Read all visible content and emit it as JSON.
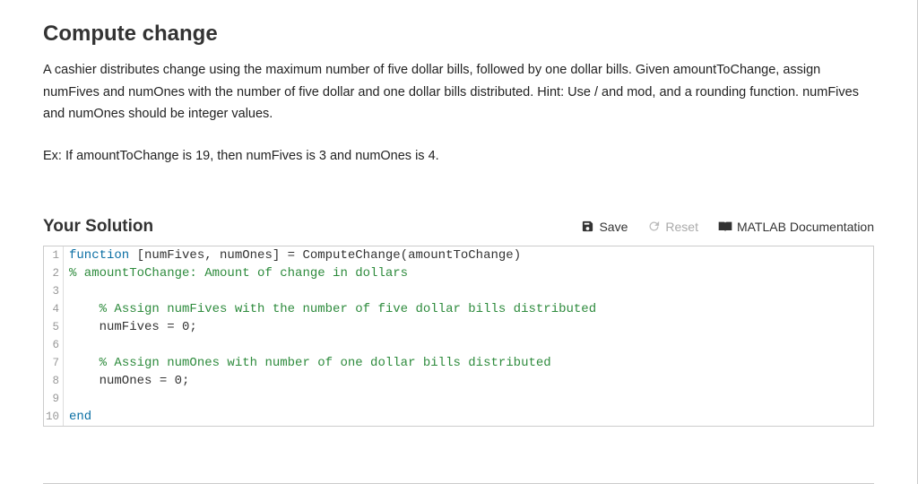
{
  "title": "Compute change",
  "description": "A cashier distributes change using the maximum number of five dollar bills, followed by one dollar bills. Given amountToChange, assign numFives and numOnes with the number of five dollar and one dollar bills distributed. Hint: Use  / and mod, and a rounding function. numFives and numOnes should be integer values.",
  "example": "Ex: If amountToChange is 19, then numFives is 3 and numOnes is 4.",
  "solution": {
    "heading": "Your Solution",
    "actions": {
      "save": "Save",
      "reset": "Reset",
      "docs": "MATLAB Documentation"
    }
  },
  "code": {
    "lines": [
      {
        "n": "1",
        "html": "<span class=\"kw\">function</span> [numFives, numOnes] = ComputeChange(amountToChange)"
      },
      {
        "n": "2",
        "html": "<span class=\"com\">% amountToChange: Amount of change in dollars</span>"
      },
      {
        "n": "3",
        "html": ""
      },
      {
        "n": "4",
        "html": "    <span class=\"com\">% Assign numFives with the number of five dollar bills distributed</span>"
      },
      {
        "n": "5",
        "html": "    numFives = 0;"
      },
      {
        "n": "6",
        "html": ""
      },
      {
        "n": "7",
        "html": "    <span class=\"com\">% Assign numOnes with number of one dollar bills distributed</span>"
      },
      {
        "n": "8",
        "html": "    numOnes = 0;"
      },
      {
        "n": "9",
        "html": ""
      },
      {
        "n": "10",
        "html": "<span class=\"kw\">end</span>"
      }
    ]
  }
}
